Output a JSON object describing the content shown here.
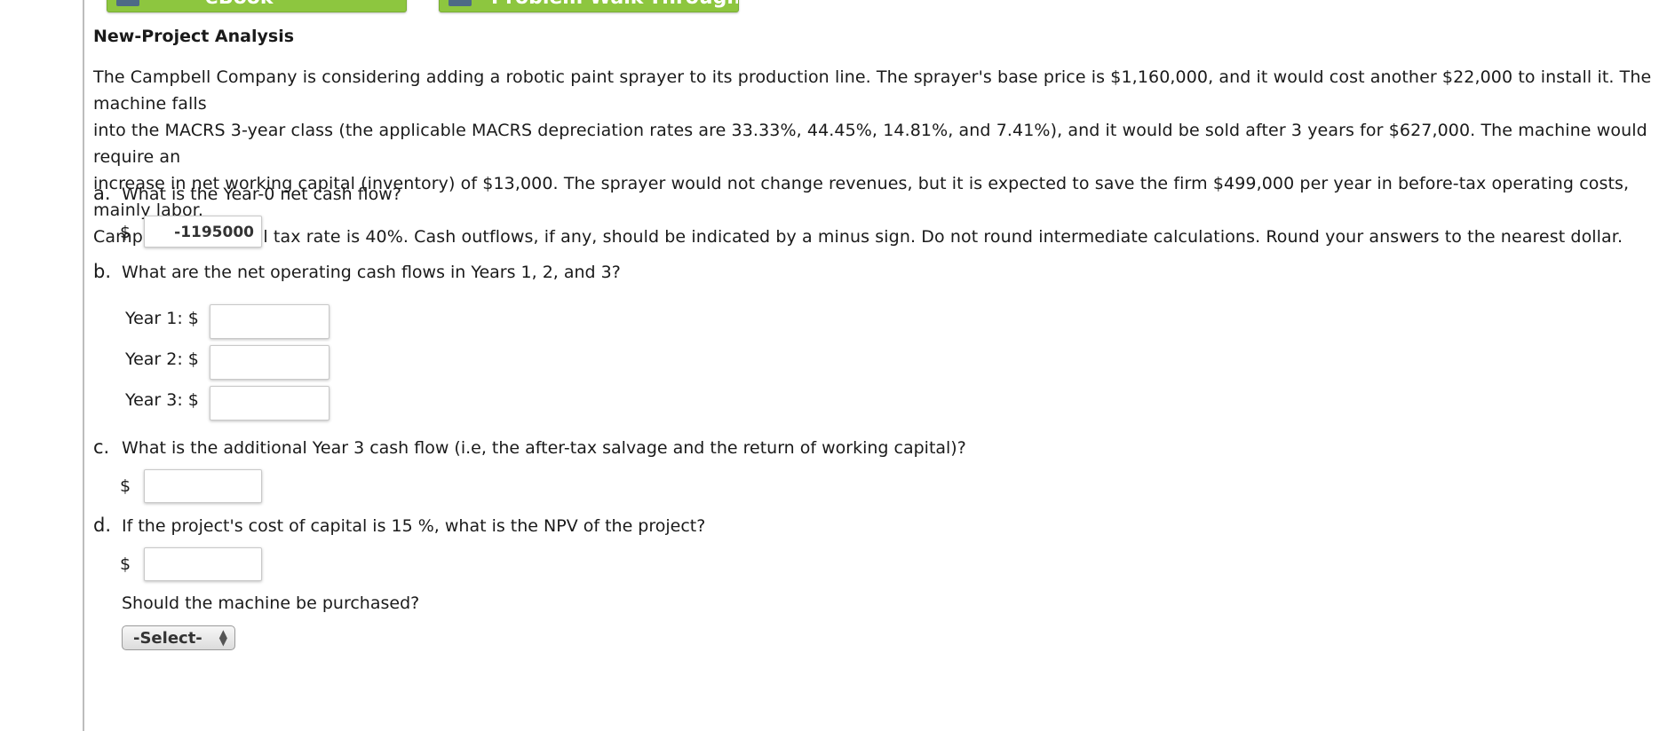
{
  "toolbar": {
    "ebook_label": "eBook",
    "walkthrough_label": "Problem Walk-Through"
  },
  "title": "New-Project Analysis",
  "problem_lines": [
    "The Campbell Company is considering adding a robotic paint sprayer to its production line. The sprayer's base price is $1,160,000, and it would cost another $22,000 to install it. The machine falls",
    "into the MACRS 3-year class (the applicable MACRS depreciation rates are 33.33%, 44.45%, 14.81%, and 7.41%), and it would be sold after 3 years for $627,000. The machine would require an",
    "increase in net working capital (inventory) of $13,000. The sprayer would not change revenues, but it is expected to save the firm $499,000 per year in before-tax operating costs, mainly labor.",
    "Campbell's marginal tax rate is 40%. Cash outflows, if any, should be indicated by a minus sign. Do not round intermediate calculations. Round your answers to the nearest dollar."
  ],
  "questions": {
    "a": {
      "letter": "a.",
      "text": "What is the Year-0 net cash flow?",
      "dollar": "$",
      "value": "-1195000"
    },
    "b": {
      "letter": "b.",
      "text": "What are the net operating cash flows in Years 1, 2, and 3?",
      "years": [
        {
          "label": "Year 1: $",
          "value": ""
        },
        {
          "label": "Year 2: $",
          "value": ""
        },
        {
          "label": "Year 3: $",
          "value": ""
        }
      ]
    },
    "c": {
      "letter": "c.",
      "text": "What is the additional Year 3 cash flow (i.e, the after-tax salvage and the return of working capital)?",
      "dollar": "$",
      "value": ""
    },
    "d": {
      "letter": "d.",
      "text": "If the project's cost of capital is 15 %, what is the NPV of the project?",
      "dollar": "$",
      "value": "",
      "followup": "Should the machine be purchased?",
      "select_value": "-Select-"
    }
  },
  "colors": {
    "button_green": "#8dc63f",
    "rule_gray": "#bdbdbd"
  }
}
